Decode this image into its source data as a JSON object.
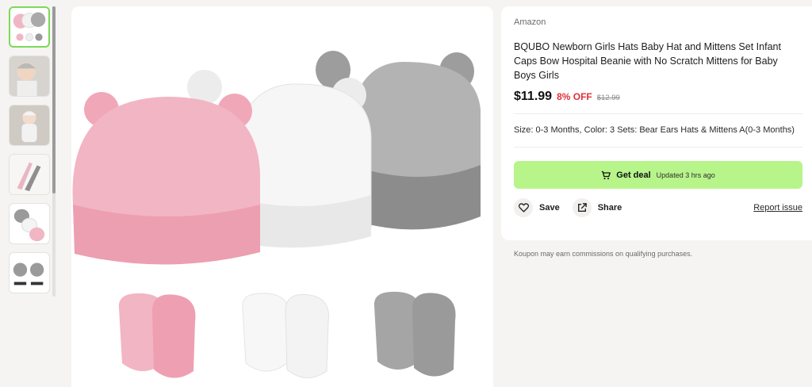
{
  "thumbnails": [
    {
      "name": "hats-mittens-set"
    },
    {
      "name": "baby-wearing-hat"
    },
    {
      "name": "baby-lying-down"
    },
    {
      "name": "mittens-detail"
    },
    {
      "name": "hats-stacked"
    },
    {
      "name": "size-chart"
    }
  ],
  "product": {
    "store": "Amazon",
    "title": "BQUBO Newborn Girls Hats Baby Hat and Mittens Set Infant Caps Bow Hospital Beanie with No Scratch Mittens for Baby Boys Girls",
    "price": "$11.99",
    "discount": "8% OFF",
    "original_price": "$12.99",
    "variant": "Size: 0-3 Months, Color: 3 Sets: Bear Ears Hats & Mittens A(0-3 Months)"
  },
  "deal": {
    "label": "Get deal",
    "updated": "Updated 3 hrs ago",
    "color": "#b7f58b",
    "icon": "cart-icon"
  },
  "actions": {
    "save": "Save",
    "share": "Share",
    "report": "Report issue"
  },
  "disclaimer": "Koupon may earn commissions on qualifying purchases.",
  "colors": {
    "discount": "#e0303b",
    "active_thumb_border": "#7ed957"
  }
}
